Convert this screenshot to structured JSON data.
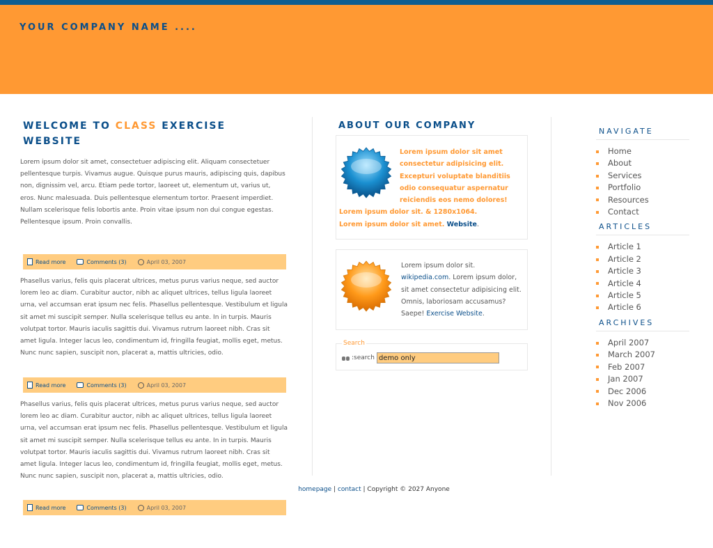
{
  "site": {
    "title": "YOUR COMPANY NAME ...."
  },
  "colors": {
    "accent": "#ff9933",
    "brand": "#0b4f8a",
    "topbar": "#0f5e91",
    "postbar": "#ffcc80"
  },
  "main": {
    "heading_pre": "WELCOME TO ",
    "heading_highlight": "CLASS",
    "heading_post": " EXERCISE WEBSITE",
    "posts": [
      {
        "text": "Lorem ipsum dolor sit amet, consectetuer adipiscing elit. Aliquam consectetuer pellentesque turpis. Vivamus augue. Quisque purus mauris, adipiscing quis, dapibus non, dignissim vel, arcu. Etiam pede tortor, laoreet ut, elementum ut, varius ut, eros. Nunc malesuada. Duis pellentesque elementum tortor. Praesent imperdiet. Nullam scelerisque felis lobortis ante. Proin vitae ipsum non dui congue egestas. Pellentesque ipsum. Proin convallis.",
        "read_more": "Read more",
        "comments": "Comments (3)",
        "date": "April 03, 2007"
      },
      {
        "text": "Phasellus varius, felis quis placerat ultrices, metus purus varius neque, sed auctor lorem leo ac diam. Curabitur auctor, nibh ac aliquet ultrices, tellus ligula laoreet urna, vel accumsan erat ipsum nec felis. Phasellus pellentesque. Vestibulum et ligula sit amet mi suscipit semper. Nulla scelerisque tellus eu ante. In in turpis. Mauris volutpat tortor. Mauris iaculis sagittis dui. Vivamus rutrum laoreet nibh. Cras sit amet ligula. Integer lacus leo, condimentum id, fringilla feugiat, mollis eget, metus. Nunc nunc sapien, suscipit non, placerat a, mattis ultricies, odio.",
        "read_more": "Read more",
        "comments": "Comments (3)",
        "date": "April 03, 2007"
      },
      {
        "text": "Phasellus varius, felis quis placerat ultrices, metus purus varius neque, sed auctor lorem leo ac diam. Curabitur auctor, nibh ac aliquet ultrices, tellus ligula laoreet urna, vel accumsan erat ipsum nec felis. Phasellus pellentesque. Vestibulum et ligula sit amet mi suscipit semper. Nulla scelerisque tellus eu ante. In in turpis. Mauris volutpat tortor. Mauris iaculis sagittis dui. Vivamus rutrum laoreet nibh. Cras sit amet ligula. Integer lacus leo, condimentum id, fringilla feugiat, mollis eget, metus. Nunc nunc sapien, suscipit non, placerat a, mattis ultricies, odio.",
        "read_more": "Read more",
        "comments": "Comments (3)",
        "date": "April 03, 2007"
      }
    ]
  },
  "about": {
    "title": "ABOUT OUR COMPANY",
    "box1_text": "Lorem ipsum dolor sit amet consectetur adipisicing elit. Excepturi voluptate blanditiis odio consequatur aspernatur reiciendis eos nemo dolores! Lorem ipsum dolor sit. & 1280x1064.",
    "box1_text2": "Lorem ipsum dolor sit amet. ",
    "box1_link": "Website",
    "box2_pre": "Lorem ipsum dolor sit. ",
    "box2_link1": "wikipedia.com",
    "box2_mid": ". Lorem ipsum dolor, sit amet consectetur adipisicing elit. Omnis, laboriosam accusamus? Saepe! ",
    "box2_link2": "Exercise Website",
    "box2_end": "."
  },
  "search": {
    "legend": "Search",
    "label": ":search",
    "value": "demo only"
  },
  "sidebar": {
    "navigate_title": "NAVIGATE",
    "navigate": [
      "Home",
      "About",
      "Services",
      "Portfolio",
      "Resources",
      "Contact"
    ],
    "articles_title": "ARTICLES",
    "articles": [
      "Article 1",
      "Article 2",
      "Article 3",
      "Article 4",
      "Article 5",
      "Article 6"
    ],
    "archives_title": "ARCHIVES",
    "archives": [
      "April 2007",
      "March 2007",
      "Feb 2007",
      "Jan 2007",
      "Dec 2006",
      "Nov 2006"
    ]
  },
  "footer": {
    "link1": "homepage",
    "sep": " | ",
    "link2": "contact",
    "copyright": "Copyright © 2027 Anyone"
  }
}
